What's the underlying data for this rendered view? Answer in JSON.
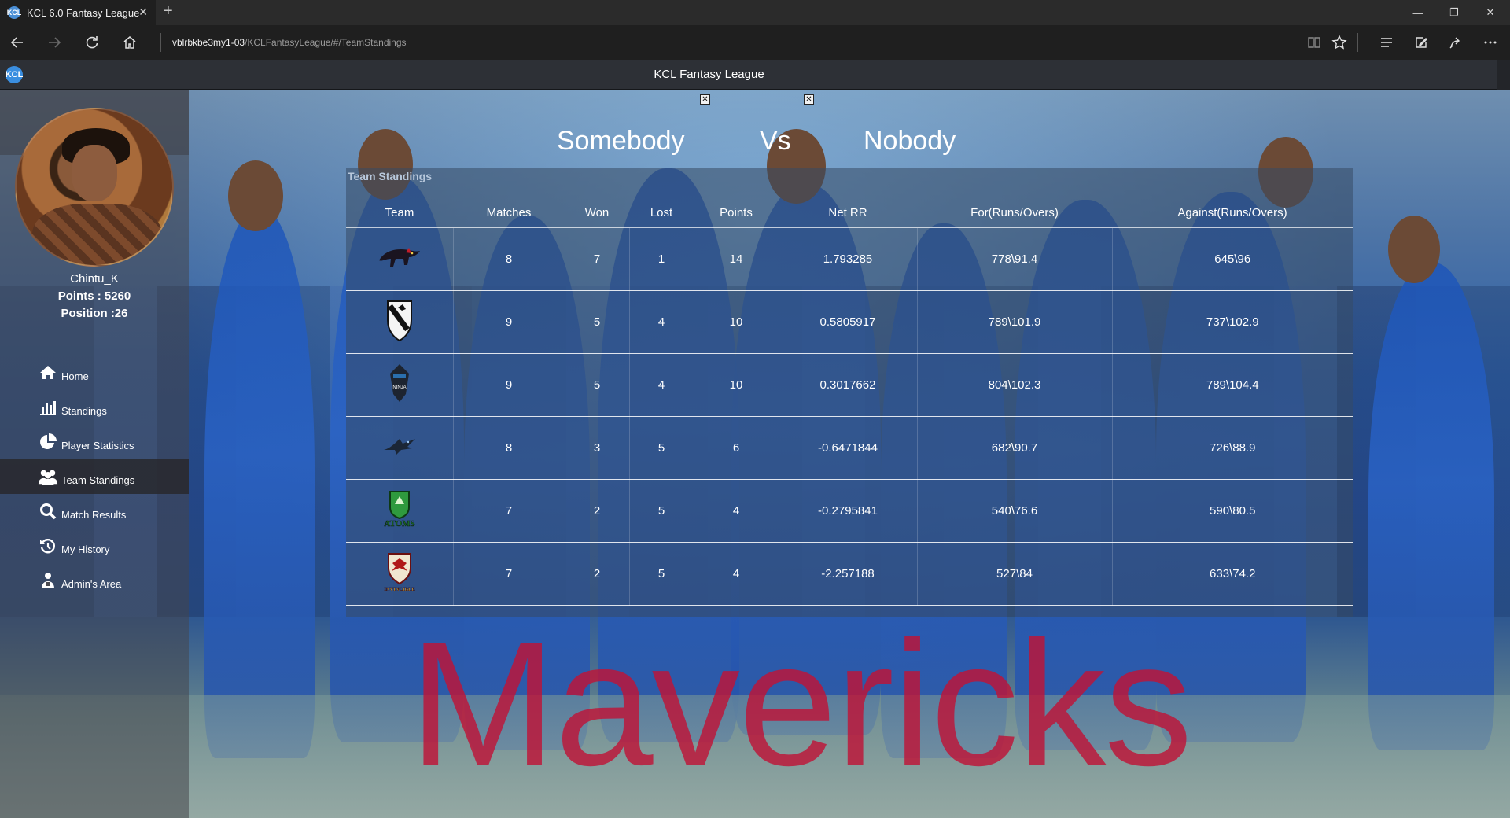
{
  "browser": {
    "tab_title": "KCL 6.0 Fantasy League",
    "tab_favicon": "KCL",
    "url_host": "vblrbkbe3my1-03",
    "url_path": "/KCLFantasyLeague/#/TeamStandings"
  },
  "app": {
    "title": "KCL Fantasy League",
    "logo": "KCL"
  },
  "user": {
    "name": "Chintu_K",
    "points": "Points : 5260",
    "position": "Position :26"
  },
  "sidebar": {
    "items": [
      {
        "label": "Home",
        "icon": "home-icon"
      },
      {
        "label": "Standings",
        "icon": "bar-chart-icon"
      },
      {
        "label": "Player Statistics",
        "icon": "pie-chart-icon"
      },
      {
        "label": "Team Standings",
        "icon": "users-icon",
        "active": true
      },
      {
        "label": "Match Results",
        "icon": "search-icon"
      },
      {
        "label": "My History",
        "icon": "history-icon"
      },
      {
        "label": "Admin's Area",
        "icon": "admin-icon"
      }
    ]
  },
  "versus": {
    "left": "Somebody",
    "middle": "Vs",
    "right": "Nobody"
  },
  "standings": {
    "title": "Team Standings",
    "columns": [
      "Team",
      "Matches",
      "Won",
      "Lost",
      "Points",
      "Net RR",
      "For(Runs/Overs)",
      "Against(Runs/Overs)"
    ],
    "rows": [
      {
        "logo": "panther-logo",
        "matches": "8",
        "won": "7",
        "lost": "1",
        "points": "14",
        "net_rr": "1.793285",
        "for": "778\\91.4",
        "against": "645\\96"
      },
      {
        "logo": "shield-logo",
        "matches": "9",
        "won": "5",
        "lost": "4",
        "points": "10",
        "net_rr": "0.5805917",
        "for": "789\\101.9",
        "against": "737\\102.9"
      },
      {
        "logo": "ninja-logo",
        "logo_text": "NINJA",
        "matches": "9",
        "won": "5",
        "lost": "4",
        "points": "10",
        "net_rr": "0.3017662",
        "for": "804\\102.3",
        "against": "789\\104.4"
      },
      {
        "logo": "bird-logo",
        "matches": "8",
        "won": "3",
        "lost": "5",
        "points": "6",
        "net_rr": "-0.6471844",
        "for": "682\\90.7",
        "against": "726\\88.9"
      },
      {
        "logo": "atoms-logo",
        "logo_text": "ATOMS",
        "matches": "7",
        "won": "2",
        "lost": "5",
        "points": "4",
        "net_rr": "-0.2795841",
        "for": "540\\76.6",
        "against": "590\\80.5"
      },
      {
        "logo": "invincible-logo",
        "logo_text": "INVINCIBLE",
        "matches": "7",
        "won": "2",
        "lost": "5",
        "points": "4",
        "net_rr": "-2.257188",
        "for": "527\\84",
        "against": "633\\74.2"
      }
    ]
  },
  "watermark": "Mavericks",
  "colors": {
    "watermark": "#be1437",
    "appbar": "#2d3036",
    "chrome": "#1f1f1f"
  }
}
